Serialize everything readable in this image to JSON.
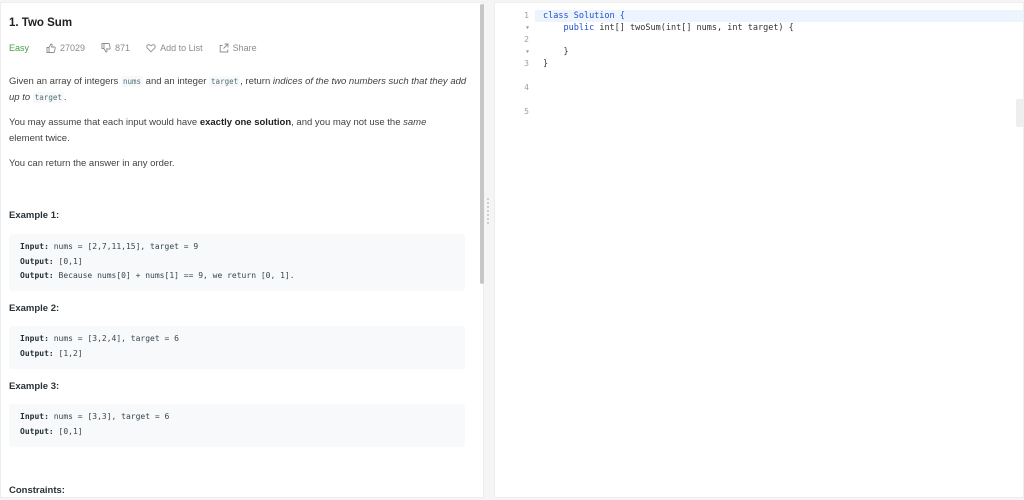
{
  "problem": {
    "title": "1. Two Sum",
    "difficulty": "Easy",
    "likes": "27029",
    "dislikes": "871",
    "add_to_list": "Add to List",
    "share": "Share"
  },
  "description": {
    "p1_a": "Given an array of integers ",
    "p1_code1": "nums",
    "p1_b": " and an integer ",
    "p1_code2": "target",
    "p1_c": ", return ",
    "p1_em": "indices of the two numbers such that they add up to",
    "p1_code3": "target",
    "p1_d": ".",
    "p2_a": "You may assume that each input would have ",
    "p2_strong": "exactly one solution",
    "p2_b": ", and you may not use the ",
    "p2_em": "same",
    "p2_c": " element twice.",
    "p3": "You can return the answer in any order."
  },
  "examples": [
    {
      "title": "Example 1:",
      "input_label": "Input:",
      "input": " nums = [2,7,11,15], target = 9",
      "output_label": "Output:",
      "output": " [0,1]",
      "explanation_label": "Output:",
      "explanation": " Because nums[0] + nums[1] == 9, we return [0, 1]."
    },
    {
      "title": "Example 2:",
      "input_label": "Input:",
      "input": " nums = [3,2,4], target = 6",
      "output_label": "Output:",
      "output": " [1,2]"
    },
    {
      "title": "Example 3:",
      "input_label": "Input:",
      "input": " nums = [3,3], target = 6",
      "output_label": "Output:",
      "output": " [0,1]"
    }
  ],
  "constraints_title": "Constraints:",
  "editor": {
    "line_numbers": [
      "1",
      "2",
      "3",
      "4",
      "5"
    ],
    "line1_kw": "class",
    "line1_rest": " Solution {",
    "line2_kw": "public",
    "line2_rest": " int[] twoSum(int[] nums, int target) {",
    "line4": "}",
    "line5": "}"
  },
  "colors": {
    "easy": "#43a047",
    "keyword": "#1a4fd0",
    "active_line": "#eef4fd"
  },
  "icons": [
    "thumbs-up-icon",
    "thumbs-down-icon",
    "heart-icon",
    "share-icon",
    "fold-arrow-icon"
  ]
}
